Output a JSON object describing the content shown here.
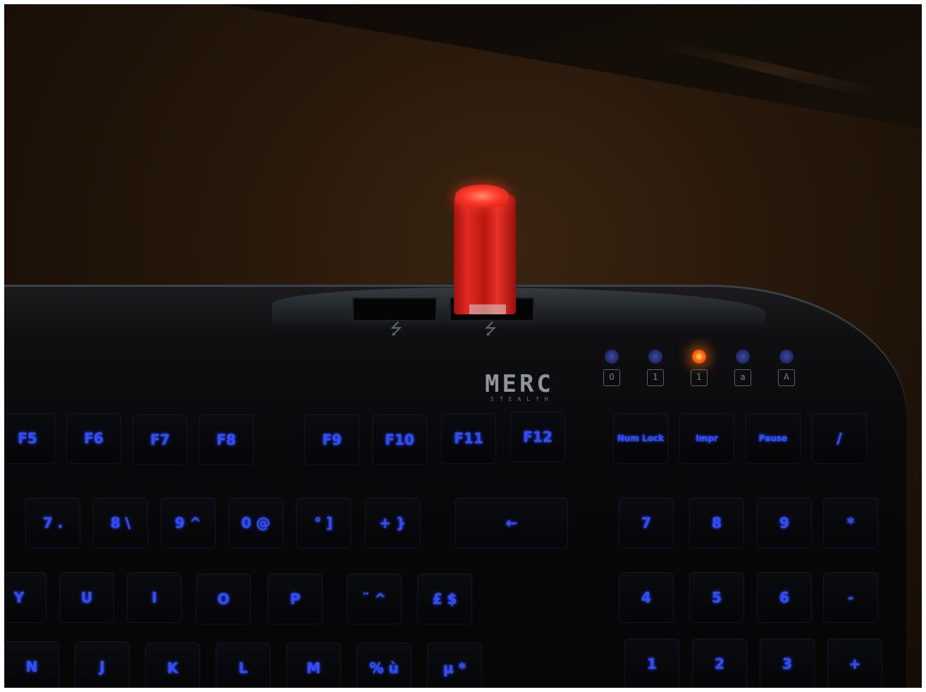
{
  "scene": {
    "description_type": "photo",
    "colors": {
      "backlight": "#2f4cff",
      "usb_drive": "#e12a22",
      "active_led": "#ff6a10"
    }
  },
  "logo": {
    "brand": "MERC",
    "sub": "STEALTH"
  },
  "usb_symbols": [
    "⭍",
    "⭍"
  ],
  "led_glyphs": [
    "0",
    "1",
    "1",
    "a",
    "A"
  ],
  "keys": {
    "function_row": [
      "F5",
      "F6",
      "F7",
      "F8",
      "F9",
      "F10",
      "F11",
      "F12"
    ],
    "num_row": [
      "7 .",
      "8 \\",
      "9 ^",
      "0 @",
      "° ]",
      "+ }",
      "←"
    ],
    "top_letters": [
      "Y",
      "U",
      "I",
      "O",
      "P",
      "¨ ^",
      "£ $"
    ],
    "home_letters": [
      "N",
      "J",
      "K",
      "L",
      "M",
      "% ù",
      "µ *"
    ],
    "right_block_top": [
      "Num Lock",
      "Impr",
      "Pause",
      "/"
    ],
    "numpad": [
      "7",
      "8",
      "9",
      "*",
      "4",
      "5",
      "6",
      "-",
      "1",
      "2",
      "3",
      "+"
    ]
  }
}
